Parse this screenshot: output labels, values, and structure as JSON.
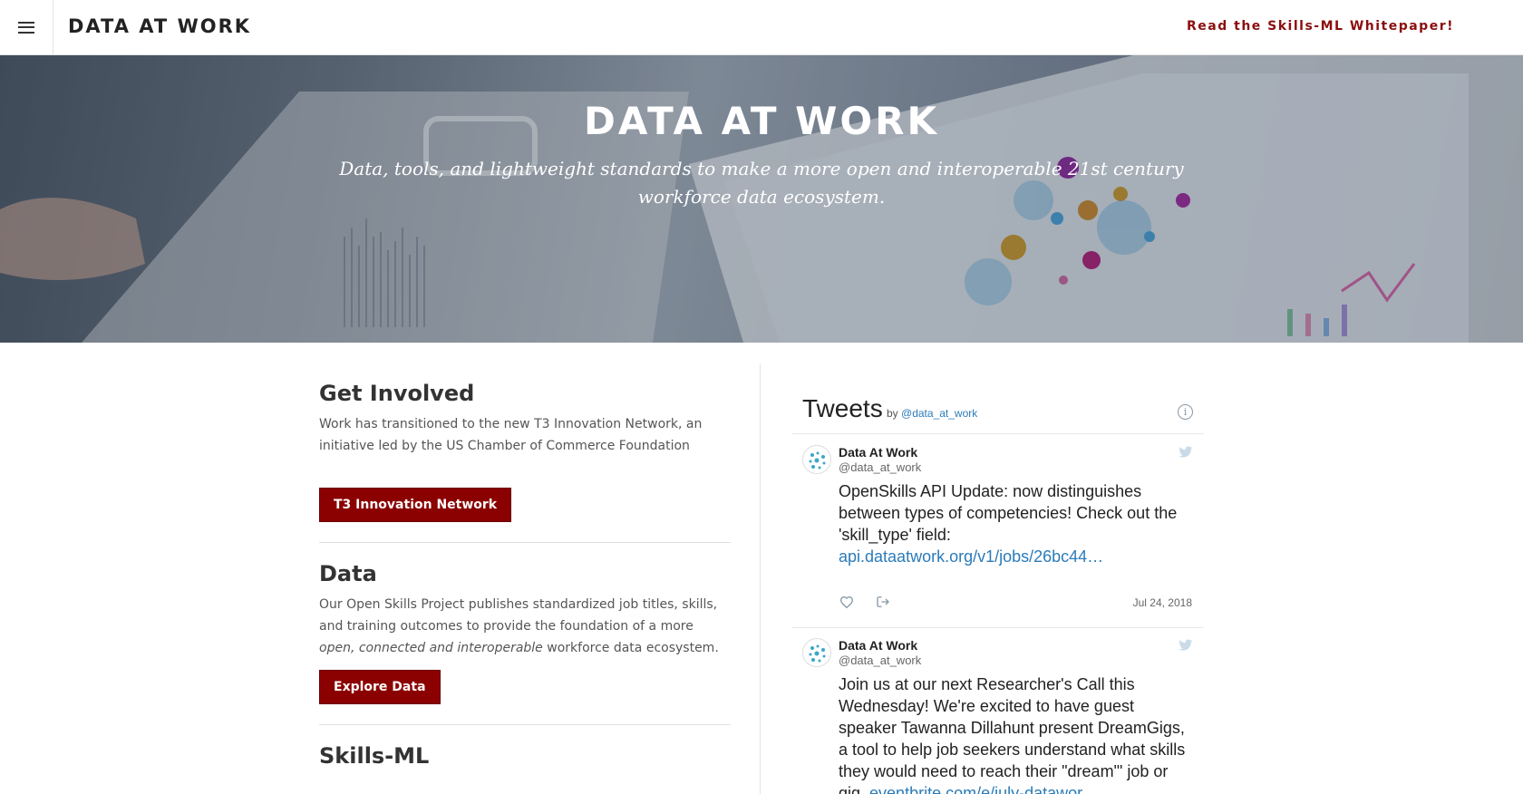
{
  "topbar": {
    "menu_icon": "hamburger-menu-icon",
    "brand": "DATA AT WORK",
    "whitepaper_link": "Read the Skills-ML Whitepaper!"
  },
  "hero": {
    "title": "DATA AT WORK",
    "subtitle": "Data, tools, and lightweight standards to make a more open and interoperable 21st century workforce data ecosystem."
  },
  "sections": {
    "get_involved": {
      "title": "Get Involved",
      "text": "Work has transitioned to the new T3 Innovation Network, an initiative led by the US Chamber of Commerce Foundation",
      "button": "T3 Innovation Network"
    },
    "data": {
      "title": "Data",
      "text_before": "Our Open Skills Project publishes standardized job titles, skills, and training outcomes to provide the foundation of a more ",
      "text_em": "open, connected and interoperable",
      "text_after": " workforce data ecosystem.",
      "button": "Explore Data"
    },
    "skills_ml": {
      "title": "Skills-ML"
    }
  },
  "tweets": {
    "title": "Tweets",
    "by": "by",
    "by_handle": "@data_at_work",
    "items": [
      {
        "name": "Data At Work",
        "handle": "@data_at_work",
        "text": "OpenSkills API Update: now distinguishes between types of competencies! Check out the 'skill_type' field: ",
        "link": "api.dataatwork.org/v1/jobs/26bc44…",
        "date": "Jul 24, 2018"
      },
      {
        "name": "Data At Work",
        "handle": "@data_at_work",
        "text": "Join us at our next Researcher's Call this Wednesday! We're excited to have guest speaker Tawanna Dillahunt present DreamGigs, a tool to help job seekers understand what skills they would need to reach their \"dream\"' job or gig. ",
        "link": "eventbrite.com/e/july-datawor…"
      }
    ]
  },
  "colors": {
    "accent": "#8b0000",
    "link": "#2b7bb9"
  }
}
